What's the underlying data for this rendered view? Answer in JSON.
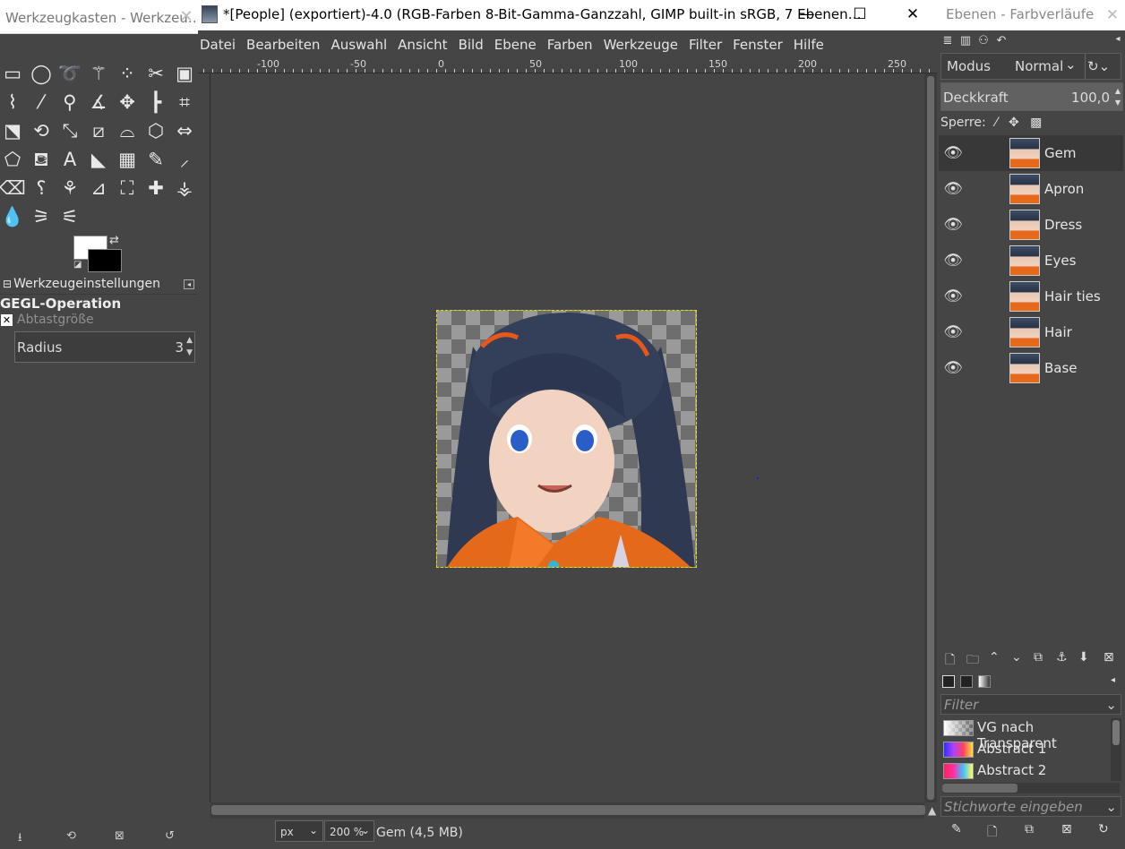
{
  "toolbox": {
    "window_title": "Werkzeugkasten - Werkzeu…",
    "close": "✕",
    "tool_icons": [
      [
        "rect-select-icon",
        "▭"
      ],
      [
        "ellipse-select-icon",
        "◯"
      ],
      [
        "free-select-icon",
        "➰"
      ],
      [
        "fuzzy-select-icon",
        "⚚"
      ],
      [
        "select-by-color-icon",
        "⁘"
      ],
      [
        "scissors-icon",
        "✂"
      ],
      [
        "foreground-select-icon",
        "▣"
      ],
      [
        "paths-icon",
        "⌇"
      ],
      [
        "color-picker-icon",
        "⁄"
      ],
      [
        "zoom-icon",
        "⚲"
      ],
      [
        "measure-icon",
        "∡"
      ],
      [
        "move-icon",
        "✥"
      ],
      [
        "align-icon",
        "┣"
      ],
      [
        "crop-icon",
        "⌗"
      ],
      [
        "unified-transform-icon",
        "⬔"
      ],
      [
        "rotate-icon",
        "⟲"
      ],
      [
        "scale-icon",
        "⤡"
      ],
      [
        "shear-icon",
        "⧄"
      ],
      [
        "warp-icon",
        "⌓"
      ],
      [
        "3d-transform-icon",
        "⬡"
      ],
      [
        "flip-icon",
        "⇔"
      ],
      [
        "cage-icon",
        "⬠"
      ],
      [
        "bucket-fill-icon",
        "⛾"
      ],
      [
        "text-icon",
        "A"
      ],
      [
        "fill-icon",
        "◣"
      ],
      [
        "gradient-icon",
        "▦"
      ],
      [
        "pencil-icon",
        "✎"
      ],
      [
        "paintbrush-icon",
        "⸝"
      ],
      [
        "eraser-icon",
        "⌫"
      ],
      [
        "airbrush-icon",
        "⸮"
      ],
      [
        "ink-icon",
        "⚘"
      ],
      [
        "mypaint-brush-icon",
        "⊿"
      ],
      [
        "clone-icon",
        "⛶"
      ],
      [
        "heal-icon",
        "✚"
      ],
      [
        "perspective-clone-icon",
        "⚶"
      ],
      [
        "blur-icon",
        "💧"
      ],
      [
        "smudge-icon",
        "⚞"
      ],
      [
        "dodge-burn-icon",
        "⚟"
      ]
    ],
    "tool_options_title": "Werkzeugeinstellungen",
    "gegl_operation": "GEGL-Operation",
    "sample_size": "Abtastgröße",
    "radius_label": "Radius",
    "radius_value": "3",
    "colors": {
      "foreground": "#ffffff",
      "background": "#000000"
    }
  },
  "main": {
    "window_title": "*[People] (exportiert)-4.0 (RGB-Farben 8-Bit-Gamma-Ganzzahl, GIMP built-in sRGB, 7 Ebenen…",
    "menu": [
      "Datei",
      "Bearbeiten",
      "Auswahl",
      "Ansicht",
      "Bild",
      "Ebene",
      "Farben",
      "Werkzeuge",
      "Filter",
      "Fenster",
      "Hilfe"
    ],
    "ruler_labels": [
      "-100",
      "-50",
      "0",
      "50",
      "100",
      "150",
      "200",
      "250"
    ],
    "status": {
      "unit": "px",
      "zoom": "200 %",
      "layer_info": "Gem (4,5 MB)"
    }
  },
  "dock": {
    "window_title": "Ebenen - Farbverläufe",
    "close": "✕",
    "mode_label": "Modus",
    "mode_value": "Normal",
    "opacity_label": "Deckkraft",
    "opacity_value": "100,0",
    "lock_label": "Sperre:",
    "layers": [
      {
        "name": "Gem",
        "selected": true
      },
      {
        "name": "Apron",
        "selected": false
      },
      {
        "name": "Dress",
        "selected": false
      },
      {
        "name": "Eyes",
        "selected": false
      },
      {
        "name": "Hair ties",
        "selected": false
      },
      {
        "name": "Hair",
        "selected": false
      },
      {
        "name": "Base",
        "selected": false
      }
    ],
    "gradients_filter_placeholder": "Filter",
    "gradients": [
      {
        "name": "VG nach Transparent"
      },
      {
        "name": "Abstract 1"
      },
      {
        "name": "Abstract 2"
      }
    ],
    "tags_placeholder": "Stichworte eingeben"
  }
}
